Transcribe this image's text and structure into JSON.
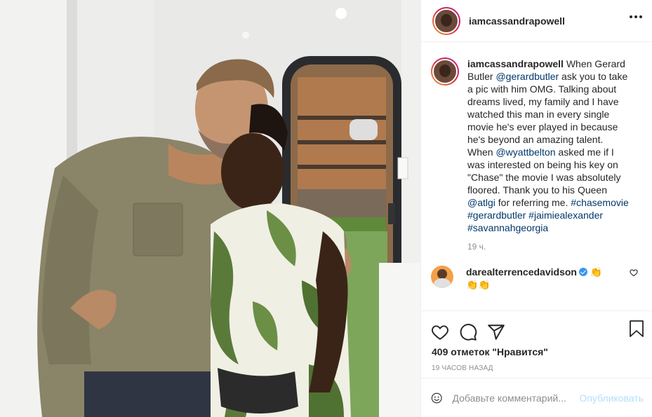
{
  "header": {
    "username": "iamcassandrapowell",
    "more_icon": "more-options-icon"
  },
  "caption": {
    "username": "iamcassandrapowell",
    "parts": {
      "t1": " When Gerard Butler ",
      "m1": "@gerardbutler",
      "t2": " ask you to take a pic with him OMG. Talking about dreams lived, my family and I have watched this man in every single movie he's ever played in because he's beyond an amazing talent. When ",
      "m2": "@wyattbelton",
      "t3": " asked me if I was interested on being his key on \"Chase\" the movie I was absolutely floored. Thank you to his Queen ",
      "m3": "@atlgi",
      "t4": " for referring me. ",
      "h1": "#chasemovie",
      "h2": "#gerardbutler",
      "h3": "#jaimiealexander",
      "h4": "#savannahgeorgia"
    },
    "time": "19 ч."
  },
  "comment": {
    "username": "darealterrencedavidson",
    "text": "👏👏👏"
  },
  "actions": {
    "icons": [
      "heart-icon",
      "comment-icon",
      "share-icon",
      "bookmark-icon"
    ],
    "likes": "409 отметок \"Нравится\"",
    "time_ago": "19 часов назад"
  },
  "add_comment": {
    "placeholder": "Добавьте комментарий...",
    "post_label": "Опубликовать"
  },
  "colors": {
    "link": "#00376b",
    "post_button_disabled": "#b2dffc",
    "verified": "#3897f0"
  }
}
